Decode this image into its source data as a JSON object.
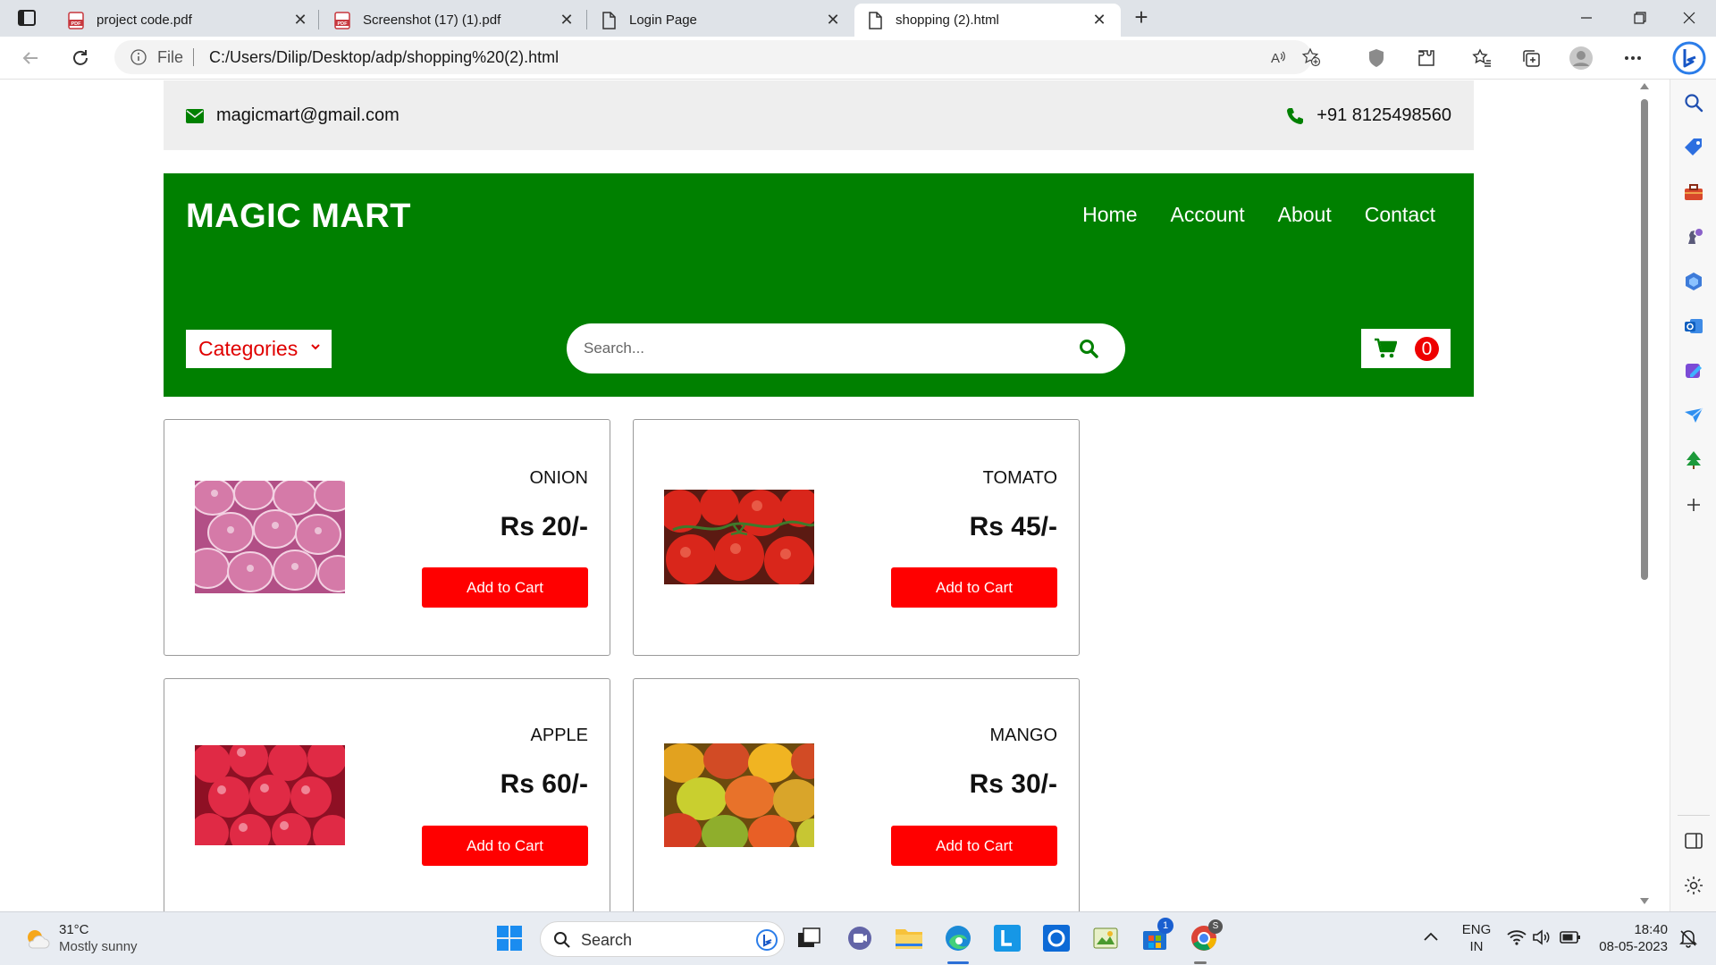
{
  "browser": {
    "tabs": [
      {
        "label": "project code.pdf",
        "icon": "pdf-icon",
        "active": false
      },
      {
        "label": "Screenshot (17) (1).pdf",
        "icon": "pdf-icon",
        "active": false
      },
      {
        "label": "Login Page",
        "icon": "page-icon",
        "active": false
      },
      {
        "label": "shopping (2).html",
        "icon": "page-icon",
        "active": true
      }
    ],
    "address": {
      "scheme_label": "File",
      "url": "C:/Users/Dilip/Desktop/adp/shopping%20(2).html"
    }
  },
  "page": {
    "contact": {
      "email": "magicmart@gmail.com",
      "phone": "+91 8125498560"
    },
    "brand": "MAGIC MART",
    "nav": [
      "Home",
      "Account",
      "About",
      "Contact"
    ],
    "categories_label": "Categories",
    "search_placeholder": "Search...",
    "cart_count": "0",
    "products": [
      {
        "name": "ONION",
        "price": "Rs 20/-",
        "button": "Add to Cart"
      },
      {
        "name": "TOMATO",
        "price": "Rs 45/-",
        "button": "Add to Cart"
      },
      {
        "name": "APPLE",
        "price": "Rs 60/-",
        "button": "Add to Cart"
      },
      {
        "name": "MANGO",
        "price": "Rs 30/-",
        "button": "Add to Cart"
      }
    ],
    "colors": {
      "header": "#008000",
      "accent": "#ff0000",
      "topbar": "#eeeeee"
    }
  },
  "taskbar": {
    "weather": {
      "temp": "31°C",
      "condition": "Mostly sunny"
    },
    "search_label": "Search",
    "language": {
      "line1": "ENG",
      "line2": "IN"
    },
    "time": "18:40",
    "date": "08-05-2023",
    "store_badge": "1"
  }
}
